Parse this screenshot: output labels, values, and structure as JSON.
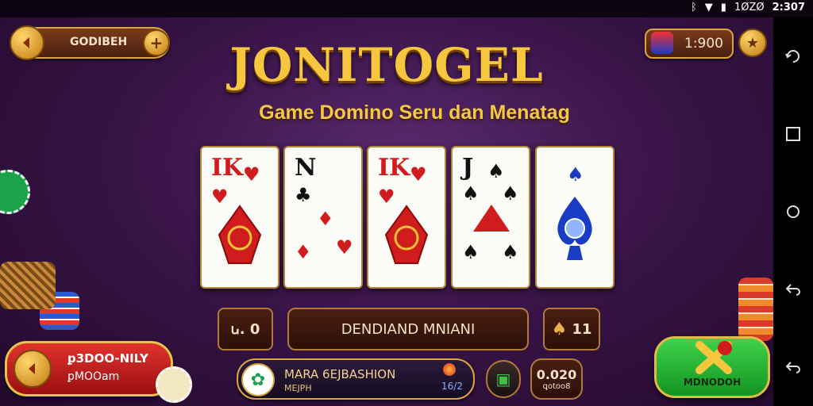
{
  "status_bar": {
    "battery": "1ØZØ",
    "time": "2:307"
  },
  "top_left": {
    "label": "GODIBEH"
  },
  "coins": {
    "amount": "1:900"
  },
  "title": "JONITOGEL",
  "subtitle": "Game Domino Seru dan Menatag",
  "cards": [
    {
      "rank": "IK",
      "color": "red"
    },
    {
      "rank": "N",
      "color": "black"
    },
    {
      "rank": "IK",
      "color": "red"
    },
    {
      "rank": "J",
      "color": "black"
    },
    {
      "rank": "",
      "color": "blue"
    }
  ],
  "controls": {
    "left_value": "ꭎ. 0",
    "center_label": "DENDIAND MNIANI",
    "right_value": "11"
  },
  "bottom_left": {
    "line1": "ꝑ3DOO-NILY",
    "line2": "ꝑMOOam"
  },
  "bottom_info": {
    "line1": "MARA 6EJBASHION",
    "line2": "MEJPH",
    "badge": "16/2"
  },
  "bottom_counter": {
    "value": "0.020",
    "sub": "ꝗotoo8"
  },
  "bottom_right": {
    "label": "MDNODOH"
  },
  "colors": {
    "gold": "#f6c73e",
    "purple_bg": "#3a1448",
    "green": "#2bb63a",
    "red": "#d01c1c"
  }
}
